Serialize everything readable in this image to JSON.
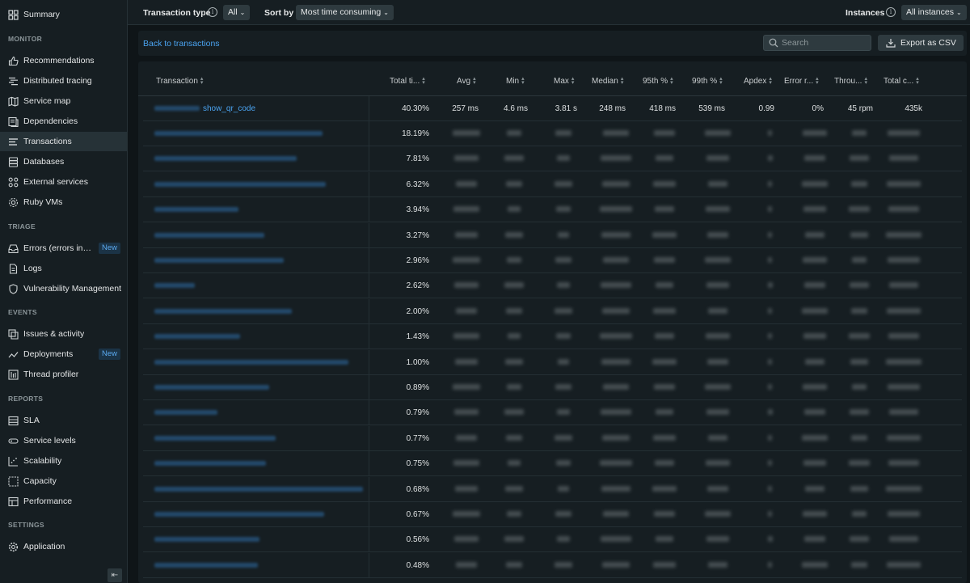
{
  "sidebar": {
    "summary": "Summary",
    "sections": {
      "monitor": "MONITOR",
      "triage": "TRIAGE",
      "events": "EVENTS",
      "reports": "REPORTS",
      "settings": "SETTINGS"
    },
    "items": {
      "recommendations": "Recommendations",
      "distributed_tracing": "Distributed tracing",
      "service_map": "Service map",
      "dependencies": "Dependencies",
      "transactions": "Transactions",
      "databases": "Databases",
      "external_services": "External services",
      "ruby_vms": "Ruby VMs",
      "errors": "Errors (errors inbox)",
      "logs": "Logs",
      "vulnerability": "Vulnerability Management",
      "issues": "Issues & activity",
      "deployments": "Deployments",
      "thread_profiler": "Thread profiler",
      "sla": "SLA",
      "service_levels": "Service levels",
      "scalability": "Scalability",
      "capacity": "Capacity",
      "performance": "Performance",
      "application": "Application"
    },
    "new_badge": "New",
    "active": "transactions",
    "collapse_icon": "collapse-left-icon"
  },
  "topbar": {
    "transaction_type_label": "Transaction type",
    "transaction_type_value": "All",
    "sort_by_label": "Sort by",
    "sort_by_value": "Most time consuming",
    "instances_label": "Instances",
    "instances_value": "All instances"
  },
  "actionbar": {
    "back_label": "Back to transactions",
    "search_placeholder": "Search",
    "export_label": "Export as CSV"
  },
  "table": {
    "columns": [
      "Transaction",
      "Total ti...",
      "Avg",
      "Min",
      "Max",
      "Median",
      "95th %",
      "99th %",
      "Apdex",
      "Error r...",
      "Throu...",
      "Total c..."
    ],
    "first_row": {
      "transaction": "show_qr_code",
      "total_time": "40.30%",
      "avg": "257 ms",
      "min": "4.6 ms",
      "max": "3.81 s",
      "median": "248 ms",
      "p95": "418 ms",
      "p99": "539 ms",
      "apdex": "0.99",
      "error_rate": "0%",
      "throughput": "45 rpm",
      "total_calls": "435k"
    },
    "other_total_time_pct": [
      "18.19%",
      "7.81%",
      "6.32%",
      "3.94%",
      "3.27%",
      "2.96%",
      "2.62%",
      "2.00%",
      "1.43%",
      "1.00%",
      "0.89%",
      "0.79%",
      "0.77%",
      "0.75%",
      "0.68%",
      "0.67%",
      "0.56%",
      "0.48%"
    ],
    "accent_color": "#4aa3f0"
  }
}
